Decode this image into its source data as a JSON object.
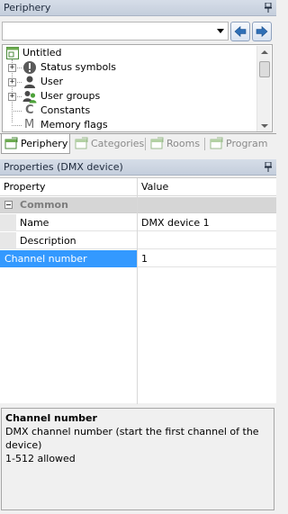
{
  "periphery": {
    "title": "Periphery",
    "combo_value": "",
    "tree": [
      {
        "label": "Untitled",
        "icon": "project-icon",
        "expander": ""
      },
      {
        "label": "Status symbols",
        "icon": "exclamation-icon",
        "expander": "+"
      },
      {
        "label": "User",
        "icon": "user-icon",
        "expander": "+"
      },
      {
        "label": "User groups",
        "icon": "user-group-icon",
        "expander": "+"
      },
      {
        "label": "Constants",
        "icon": "constants-icon",
        "expander": ""
      },
      {
        "label": "Memory flags",
        "icon": "memory-flags-icon",
        "expander": ""
      }
    ],
    "constants_glyph": "C",
    "memory_glyph": "M"
  },
  "tabs": [
    {
      "label": "Periphery",
      "active": true
    },
    {
      "label": "Categories",
      "active": false
    },
    {
      "label": "Rooms",
      "active": false
    },
    {
      "label": "Program",
      "active": false
    }
  ],
  "properties": {
    "title": "Properties (DMX device)",
    "col_property": "Property",
    "col_value": "Value",
    "category": "Common",
    "rows": [
      {
        "name": "Name",
        "value": "DMX device 1"
      },
      {
        "name": "Description",
        "value": ""
      },
      {
        "name": "Channel number",
        "value": "1"
      }
    ]
  },
  "description": {
    "title": "Channel number",
    "line1": "DMX channel number (start the first channel of the device)",
    "line2": "1-512 allowed"
  },
  "colors": {
    "selection": "#3399ff",
    "title_bar": "#c9d3e1",
    "nav_arrow": "#2f6fb6"
  }
}
